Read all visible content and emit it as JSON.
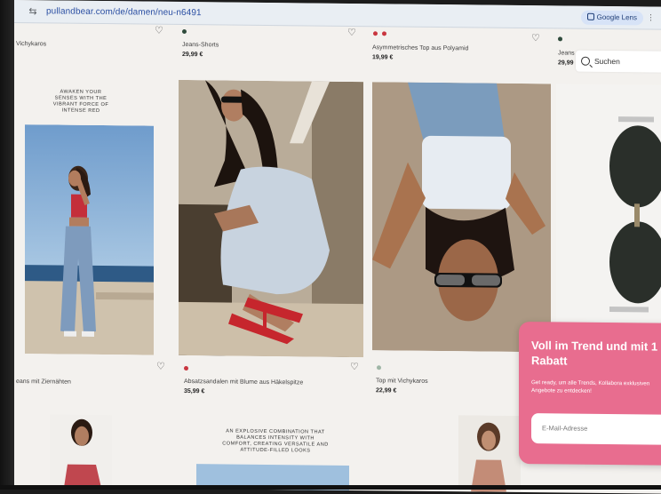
{
  "browser": {
    "url": "pullandbear.com/de/damen/neu-n6491",
    "lens_label": "Google Lens"
  },
  "search": {
    "label": "Suchen"
  },
  "products_top": [
    {
      "name": "Vichykaros",
      "price": ""
    },
    {
      "name": "Jeans-Shorts",
      "price": "29,99 €"
    },
    {
      "name": "Asymmetrisches Top aus Polyamid",
      "price": "19,99 €"
    },
    {
      "name": "Jeans",
      "price": "29,99"
    }
  ],
  "promo_text_1": "AWAKEN YOUR SENSES WITH THE VIBRANT FORCE OF INTENSE RED",
  "products_mid": [
    {
      "name": "eans mit Ziernähten",
      "price": ""
    },
    {
      "name": "Absatzsandalen mit Blume aus Häkelspitze",
      "price": "35,99 €"
    },
    {
      "name": "Top mit Vichykaros",
      "price": "22,99 €"
    }
  ],
  "promo_text_2": "AN EXPLOSIVE COMBINATION THAT BALANCES INTENSITY WITH COMFORT, CREATING VERSATILE AND ATTITUDE-FILLED LOOKS",
  "popup": {
    "title": "Voll im Trend und mit 1 Rabatt",
    "body": "Get ready, um alle Trends, Kollabora exklusiven Angebote zu entdecken!",
    "email_placeholder": "E-Mail-Adresse"
  },
  "colors": {
    "accent_pink": "#e86d8f",
    "dot_green": "#2f4b3c",
    "dot_red": "#c9363f"
  }
}
